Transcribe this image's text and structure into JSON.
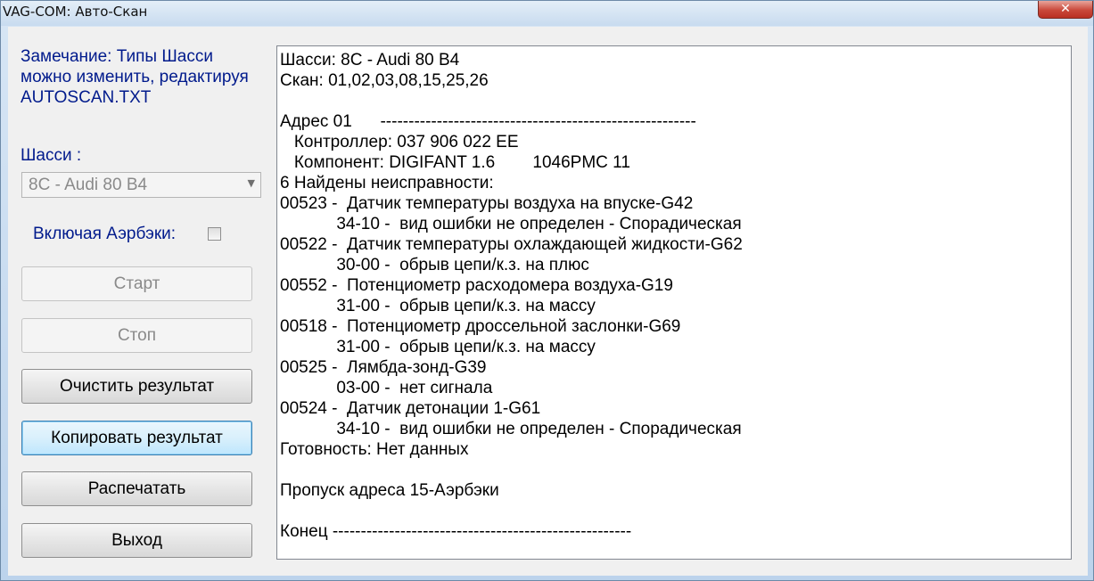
{
  "window": {
    "title": "VAG-COM: Авто-Скан",
    "close_label": "✕"
  },
  "left_panel": {
    "note_lines": [
      "Замечание: Типы Шасси",
      "можно изменить, редактируя",
      "AUTOSCAN.TXT"
    ],
    "chassis_label": "Шасси :",
    "chassis_selected": "8C - Audi 80 B4",
    "airbag_label": "Включая Аэрбэки:",
    "airbag_checked": false,
    "buttons": {
      "start": "Старт",
      "stop": "Стоп",
      "clear": "Очистить результат",
      "copy": "Копировать результат",
      "print": "Распечатать",
      "exit": "Выход"
    }
  },
  "output": {
    "lines": [
      "Шасси: 8C - Audi 80 B4",
      "Скан: 01,02,03,08,15,25,26",
      "",
      "Адрес 01      --------------------------------------------------------",
      "   Контроллер: 037 906 022 EE",
      "   Компонент: DIGIFANT 1.6        1046PMC 11",
      "6 Найдены неисправности:",
      "00523 -  Датчик температуры воздуха на впуске-G42",
      "            34-10 -  вид ошибки не определен - Спорадическая",
      "00522 -  Датчик температуры охлаждающей жидкости-G62",
      "            30-00 -  обрыв цепи/к.з. на плюс",
      "00552 -  Потенциометр расходомера воздуха-G19",
      "            31-00 -  обрыв цепи/к.з. на массу",
      "00518 -  Потенциометр дроссельной заслонки-G69",
      "            31-00 -  обрыв цепи/к.з. на массу",
      "00525 -  Лямбда-зонд-G39",
      "            03-00 -  нет сигнала",
      "00524 -  Датчик детонации 1-G61",
      "            34-10 -  вид ошибки не определен - Спорадическая",
      "Готовность: Нет данных",
      "",
      "Пропуск адреса 15-Аэрбэки",
      "",
      "Конец -----------------------------------------------------"
    ]
  }
}
